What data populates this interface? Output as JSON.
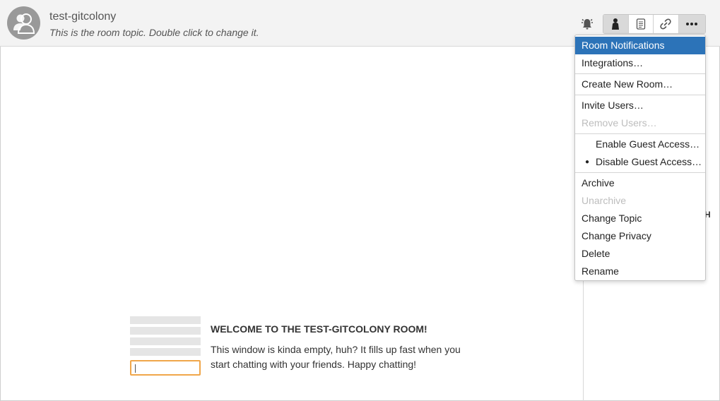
{
  "header": {
    "room_name": "test-gitcolony",
    "room_topic": "This is the room topic. Double click to change it."
  },
  "toolbar": {
    "buttons": [
      {
        "icon": "bell-icon"
      },
      {
        "icon": "person-icon",
        "active": true
      },
      {
        "icon": "document-icon"
      },
      {
        "icon": "link-icon"
      },
      {
        "icon": "more-icon",
        "active": true
      }
    ]
  },
  "menu": {
    "items": [
      {
        "label": "Room Notifications",
        "state": "selected"
      },
      {
        "label": "Integrations…"
      },
      {
        "label": "Create New Room…"
      },
      {
        "label": "Invite Users…"
      },
      {
        "label": "Remove Users…",
        "state": "disabled"
      },
      {
        "label": "Enable Guest Access…"
      },
      {
        "label": "Disable Guest Access…",
        "checked": true
      },
      {
        "label": "Archive"
      },
      {
        "label": "Unarchive",
        "state": "disabled"
      },
      {
        "label": "Change Topic"
      },
      {
        "label": "Change Privacy"
      },
      {
        "label": "Delete"
      },
      {
        "label": "Rename"
      }
    ],
    "selected_color": "#2c73b8",
    "check_bullet": "●"
  },
  "sidebar": {
    "peek_text": "H"
  },
  "welcome": {
    "title": "WELCOME TO THE TEST-GITCOLONY ROOM!",
    "body": "This window is kinda empty, huh? It fills up fast when you start chatting with your friends. Happy chatting!"
  },
  "colors": {
    "header_bg": "#f3f3f3",
    "input_focus_border": "#f0a64a"
  }
}
